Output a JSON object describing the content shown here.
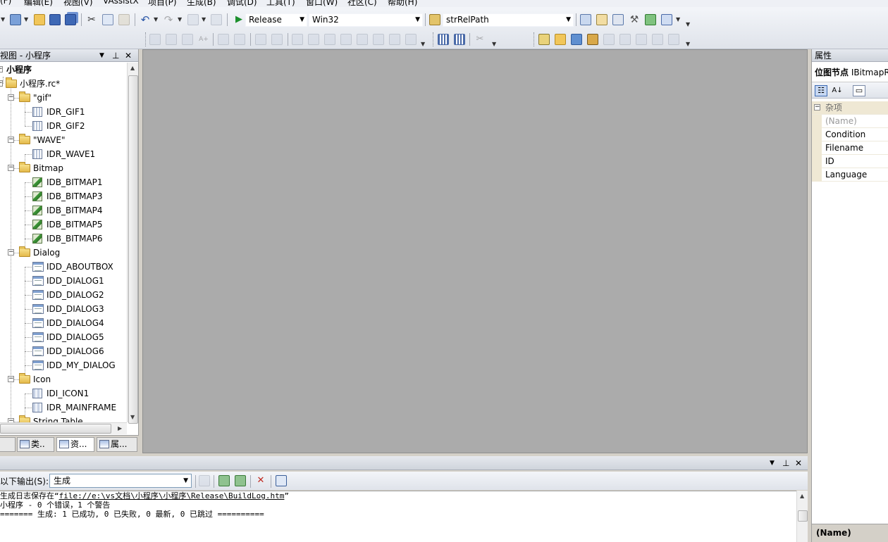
{
  "menu": [
    "(F)",
    "编辑(E)",
    "视图(V)",
    "VAssistX",
    "项目(P)",
    "生成(B)",
    "调试(D)",
    "工具(T)",
    "窗口(W)",
    "社区(C)",
    "帮助(H)"
  ],
  "toolbar": {
    "configuration": "Release",
    "platform": "Win32",
    "find_combo": "strRelPath"
  },
  "resource_view": {
    "title": "视图 - 小程序",
    "root": "小程序",
    "file": "小程序.rc*",
    "tree": [
      {
        "label": "\"gif\"",
        "type": "folder",
        "level": 2
      },
      {
        "label": "IDR_GIF1",
        "type": "file",
        "level": 3
      },
      {
        "label": "IDR_GIF2",
        "type": "file",
        "level": 3
      },
      {
        "label": "\"WAVE\"",
        "type": "folder",
        "level": 2
      },
      {
        "label": "IDR_WAVE1",
        "type": "file",
        "level": 3
      },
      {
        "label": "Bitmap",
        "type": "folder",
        "level": 2
      },
      {
        "label": "IDB_BITMAP1",
        "type": "bitmap",
        "level": 3
      },
      {
        "label": "IDB_BITMAP3",
        "type": "bitmap",
        "level": 3
      },
      {
        "label": "IDB_BITMAP4",
        "type": "bitmap",
        "level": 3
      },
      {
        "label": "IDB_BITMAP5",
        "type": "bitmap",
        "level": 3
      },
      {
        "label": "IDB_BITMAP6",
        "type": "bitmap",
        "level": 3
      },
      {
        "label": "Dialog",
        "type": "folder",
        "level": 2
      },
      {
        "label": "IDD_ABOUTBOX",
        "type": "dialog",
        "level": 3
      },
      {
        "label": "IDD_DIALOG1",
        "type": "dialog",
        "level": 3
      },
      {
        "label": "IDD_DIALOG2",
        "type": "dialog",
        "level": 3
      },
      {
        "label": "IDD_DIALOG3",
        "type": "dialog",
        "level": 3
      },
      {
        "label": "IDD_DIALOG4",
        "type": "dialog",
        "level": 3
      },
      {
        "label": "IDD_DIALOG5",
        "type": "dialog",
        "level": 3
      },
      {
        "label": "IDD_DIALOG6",
        "type": "dialog",
        "level": 3
      },
      {
        "label": "IDD_MY_DIALOG",
        "type": "dialog",
        "level": 3
      },
      {
        "label": "Icon",
        "type": "folder",
        "level": 2
      },
      {
        "label": "IDI_ICON1",
        "type": "icon",
        "level": 3
      },
      {
        "label": "IDR_MAINFRAME",
        "type": "icon",
        "level": 3
      },
      {
        "label": "String Table",
        "type": "folder",
        "level": 2
      }
    ],
    "tabs": [
      "类..",
      "资...",
      "属..."
    ]
  },
  "properties": {
    "title": "属性",
    "object_label": "位图节点",
    "object_type": "IBitmapR",
    "category": "杂项",
    "rows": [
      "(Name)",
      "Condition",
      "Filename",
      "ID",
      "Language"
    ],
    "description_title": "(Name)"
  },
  "output": {
    "show_label": "以下输出(S):",
    "source": "生成",
    "lines": [
      {
        "prefix": "生成日志保存在“",
        "link": "file://e:\\vs文档\\小程序\\小程序\\Release\\BuildLog.htm",
        "suffix": "”"
      },
      {
        "prefix": "小程序 - 0 个错误，1 个警告",
        "link": "",
        "suffix": ""
      },
      {
        "prefix": "======= 生成: 1 已成功, 0 已失败, 0 最新, 0 已跳过 ==========",
        "link": "",
        "suffix": ""
      }
    ]
  },
  "colors": {
    "editor_bg": "#ababab",
    "panel_header": "#d6dbe4",
    "prop_gutter": "#efe8d4"
  }
}
